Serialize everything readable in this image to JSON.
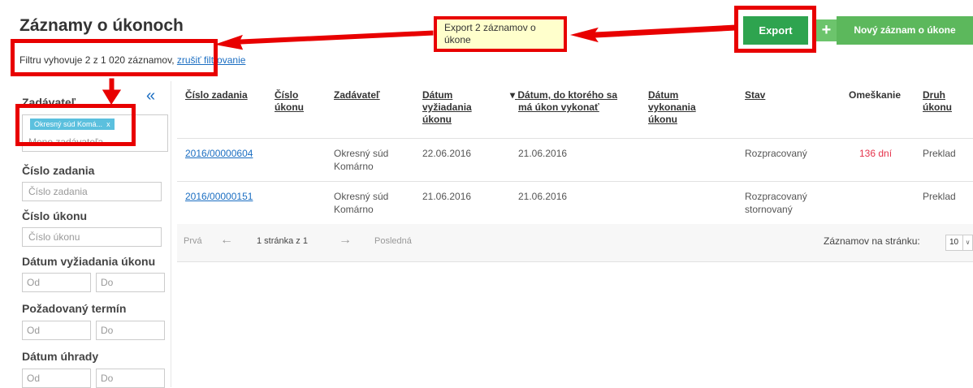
{
  "page": {
    "title": "Záznamy o úkonoch",
    "filter_info": "Filtru vyhovuje 2 z 1 020 záznamov,",
    "cancel_filter": "zrušiť filtrovanie"
  },
  "toolbar": {
    "export_label": "Export",
    "new_label": "Nový záznam o úkone",
    "plus": "+"
  },
  "callout": {
    "text": "Export 2 záznamov o úkone"
  },
  "sidebar": {
    "collapse": "«",
    "zadavatel_label": "Zadávateľ",
    "zadavatel_tag": "Okresný súd Komá...",
    "zadavatel_tag_remove": "x",
    "zadavatel_placeholder": "Meno zadávateľa",
    "cislo_zadania_label": "Číslo zadania",
    "cislo_zadania_placeholder": "Číslo zadania",
    "cislo_ukonu_label": "Číslo úkonu",
    "cislo_ukonu_placeholder": "Číslo úkonu",
    "datum_vyziadania_label": "Dátum vyžiadania úkonu",
    "pozadovany_termin_label": "Požadovaný termín",
    "datum_uhrady_label": "Dátum úhrady",
    "od": "Od",
    "do": "Do"
  },
  "table": {
    "headers": {
      "cislo_zadania": "Číslo zadania",
      "cislo_ukonu_1": "Číslo",
      "cislo_ukonu_2": "úkonu",
      "zadavatel": "Zadávateľ",
      "datum_vyz_1": "Dátum",
      "datum_vyz_2": "vyžiadania",
      "datum_vyz_3": "úkonu",
      "datum_do_1": "Dátum, do ktorého sa",
      "datum_do_2": "má úkon vykonať",
      "datum_vyk_1": "Dátum",
      "datum_vyk_2": "vykonania",
      "datum_vyk_3": "úkonu",
      "stav": "Stav",
      "omeskanie": "Omeškanie",
      "druh_1": "Druh",
      "druh_2": "úkonu",
      "sort_indicator": "▾"
    },
    "rows": [
      {
        "cislo_zadania": "2016/00000604",
        "zadavatel_1": "Okresný súd",
        "zadavatel_2": "Komárno",
        "datum_vyz": "22.06.2016",
        "datum_do": "21.06.2016",
        "stav_1": "Rozpracovaný",
        "stav_2": "",
        "omeskanie": "136 dní",
        "druh": "Preklad"
      },
      {
        "cislo_zadania": "2016/00000151",
        "zadavatel_1": "Okresný súd",
        "zadavatel_2": "Komárno",
        "datum_vyz": "21.06.2016",
        "datum_do": "21.06.2016",
        "stav_1": "Rozpracovaný",
        "stav_2": "stornovaný",
        "omeskanie": "",
        "druh": "Preklad"
      }
    ]
  },
  "pager": {
    "first": "Prvá",
    "prev": "←",
    "page_info": "1 stránka z 1",
    "next": "→",
    "last": "Posledná",
    "per_page_label": "Záznamov na stránku:",
    "per_page_value": "10",
    "caret": "∨"
  },
  "colors": {
    "annotation_red": "#e80000",
    "export_green": "#2ea44f",
    "new_green": "#5cb85c",
    "link_blue": "#1b6ec2",
    "overdue_red": "#e5334b",
    "callout_yellow": "#ffffcc"
  }
}
